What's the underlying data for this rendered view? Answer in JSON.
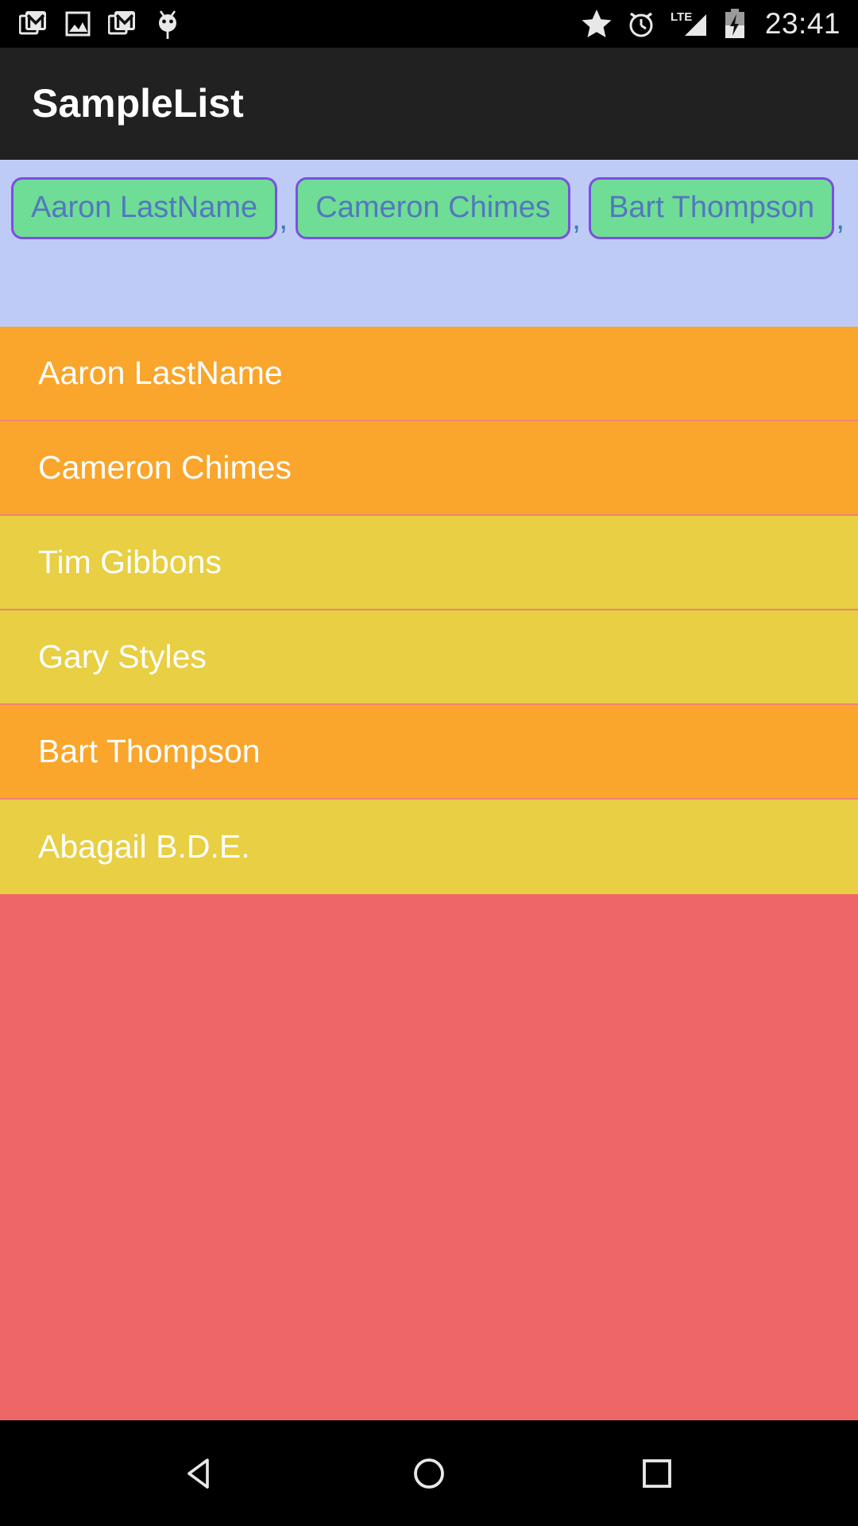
{
  "status_bar": {
    "icons_left": [
      {
        "name": "gmail-icon",
        "label": "Gmail"
      },
      {
        "name": "photo-icon",
        "label": "Screenshot"
      },
      {
        "name": "gmail-icon-2",
        "label": "Gmail"
      },
      {
        "name": "android-debug-icon",
        "label": "USB debugging"
      }
    ],
    "icons_right": [
      {
        "name": "star-icon",
        "label": "Starred"
      },
      {
        "name": "alarm-icon",
        "label": "Alarm set"
      },
      {
        "name": "lte-signal-icon",
        "label": "LTE"
      },
      {
        "name": "battery-charging-icon",
        "label": "Charging"
      }
    ],
    "network_label": "LTE",
    "clock": "23:41"
  },
  "toolbar": {
    "title": "SampleList"
  },
  "chip_area": {
    "background_color": "#BFCBF7",
    "chip_fill_color": "#6FDD96",
    "chip_border_color": "#7B4FE0",
    "chip_text_color": "#5278BE",
    "separator": ",",
    "chips": [
      {
        "label": "Aaron LastName"
      },
      {
        "label": "Cameron Chimes"
      },
      {
        "label": "Bart Thompson"
      }
    ]
  },
  "list": {
    "empty_background_color": "#EE6767",
    "divider_color": "#EE8373",
    "color_selected": "#FAA52B",
    "color_unselected": "#E8CF43",
    "rows": [
      {
        "label": "Aaron LastName",
        "color": "#FAA52B",
        "selected": true
      },
      {
        "label": "Cameron Chimes",
        "color": "#FAA52B",
        "selected": true
      },
      {
        "label": "Tim Gibbons",
        "color": "#E8CF43",
        "selected": false
      },
      {
        "label": "Gary Styles",
        "color": "#E8CF43",
        "selected": false
      },
      {
        "label": "Bart Thompson",
        "color": "#FAA52B",
        "selected": true
      },
      {
        "label": "Abagail B.D.E.",
        "color": "#E8CF43",
        "selected": false
      }
    ]
  },
  "nav_bar": {
    "buttons": [
      {
        "name": "back-icon",
        "label": "Back"
      },
      {
        "name": "home-icon",
        "label": "Home"
      },
      {
        "name": "recents-icon",
        "label": "Recents"
      }
    ]
  }
}
